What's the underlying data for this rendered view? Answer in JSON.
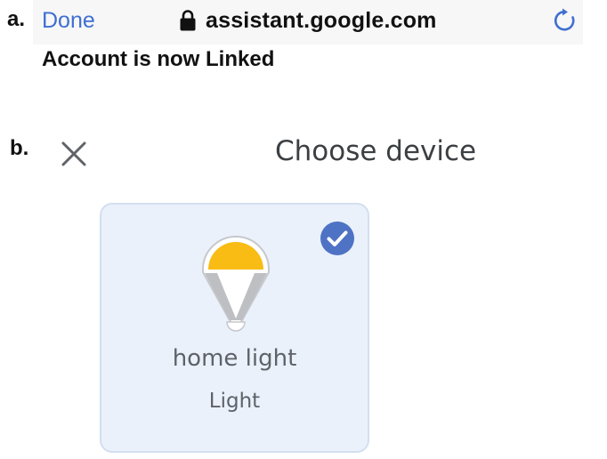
{
  "step_a": {
    "label": "a.",
    "browser": {
      "done_label": "Done",
      "lock_icon": "lock-icon",
      "url": "assistant.google.com",
      "reload_icon": "reload-icon",
      "accent_color": "#3f6fd1"
    },
    "status": "Account is now Linked"
  },
  "step_b": {
    "label": "b.",
    "dialog": {
      "close_icon": "close-icon",
      "title": "Choose device"
    },
    "device_card": {
      "selected": true,
      "check_icon": "check-circle-icon",
      "device_icon": "light-bulb-icon",
      "name": "home light",
      "type": "Light",
      "check_color": "#4e72c4",
      "bulb_color": "#f9bc15"
    }
  }
}
